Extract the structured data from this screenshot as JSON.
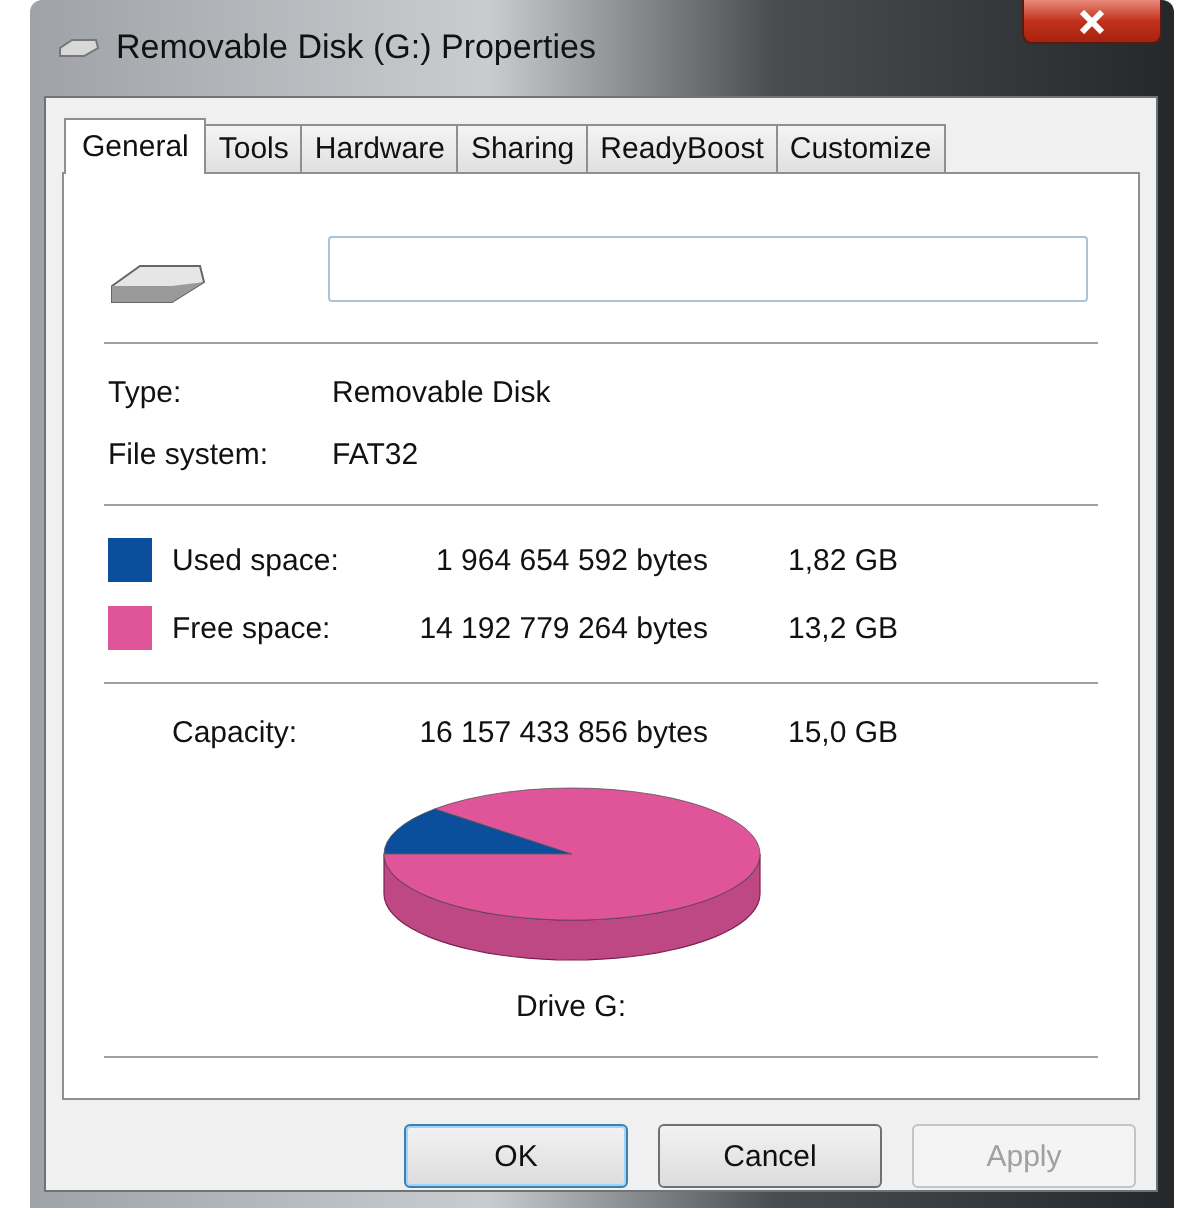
{
  "window": {
    "title": "Removable Disk (G:) Properties"
  },
  "tabs": [
    {
      "label": "General",
      "selected": true
    },
    {
      "label": "Tools",
      "selected": false
    },
    {
      "label": "Hardware",
      "selected": false
    },
    {
      "label": "Sharing",
      "selected": false
    },
    {
      "label": "ReadyBoost",
      "selected": false
    },
    {
      "label": "Customize",
      "selected": false
    }
  ],
  "info": [
    {
      "label": "Type:",
      "value": "Removable Disk"
    },
    {
      "label": "File system:",
      "value": "FAT32"
    }
  ],
  "space": [
    {
      "label": "Used space:",
      "bytes": "1 964 654 592 bytes",
      "size": "1,82 GB",
      "color": "#0b4f9c"
    },
    {
      "label": "Free space:",
      "bytes": "14 192 779 264 bytes",
      "size": "13,2 GB",
      "color": "#e0559a"
    }
  ],
  "capacity": {
    "label": "Capacity:",
    "bytes": "16 157 433 856 bytes",
    "size": "15,0 GB"
  },
  "usage_chart": {
    "kind": "pie",
    "caption": "Drive G:"
  },
  "buttons": [
    {
      "label": "OK",
      "default": true,
      "disabled": false
    },
    {
      "label": "Cancel",
      "default": false,
      "disabled": false
    },
    {
      "label": "Apply",
      "default": false,
      "disabled": true
    }
  ]
}
